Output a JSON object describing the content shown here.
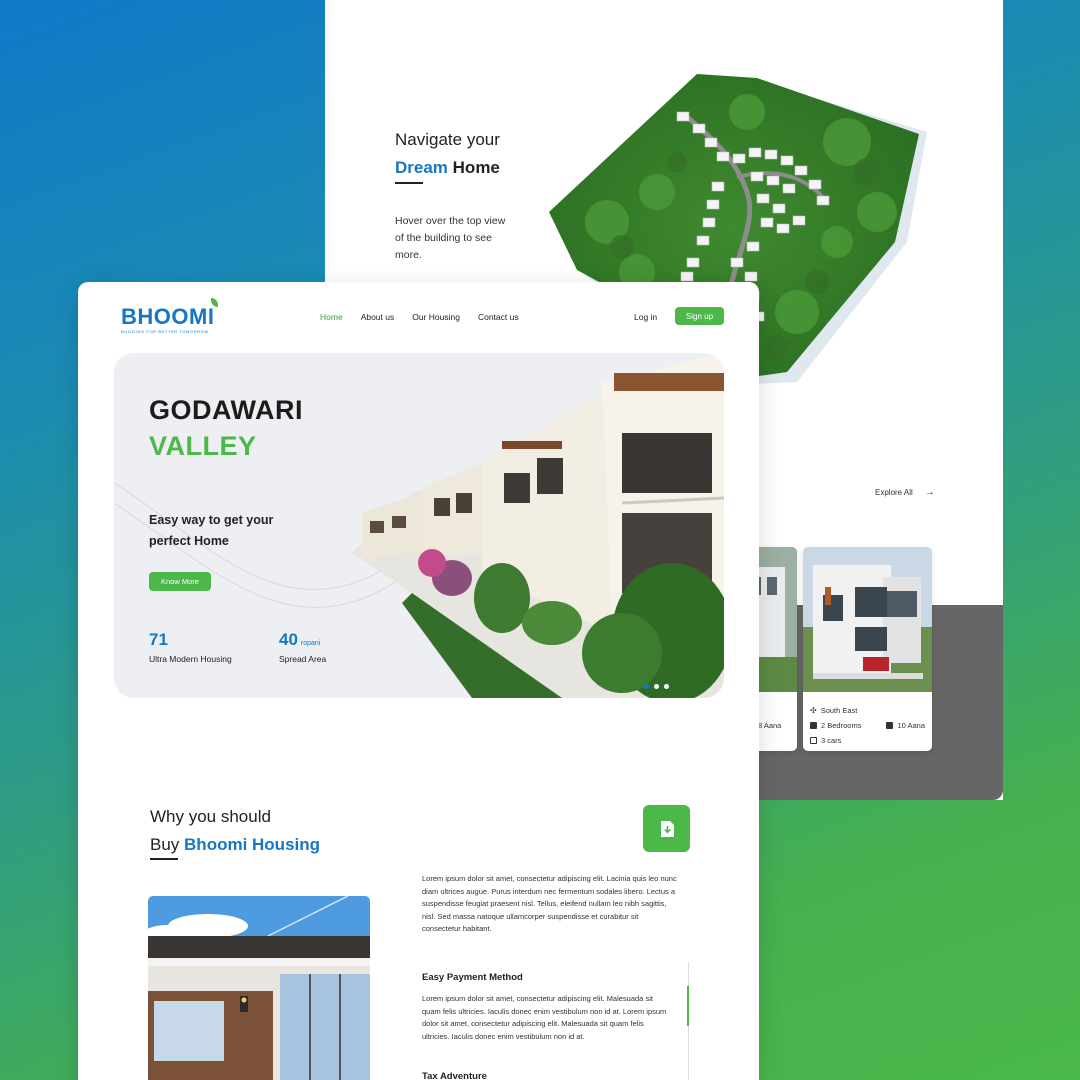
{
  "back": {
    "heading_line1": "Navigate your",
    "heading_highlight": "Dream",
    "heading_rest": "Home",
    "description": "Hover over the top view of the building to see more.",
    "explore_label": "Explore All",
    "cards": [
      {
        "partial_text": "8 Aana"
      },
      {
        "direction": "South East",
        "bedrooms": "2 Bedrooms",
        "area": "10 Aana",
        "parking": "3 cars"
      }
    ]
  },
  "front": {
    "logo": {
      "name": "BHOOMI",
      "tagline": "BUILDING FOR BETTER TOMORROW"
    },
    "nav": {
      "home": "Home",
      "about": "About us",
      "housing": "Our Housing",
      "contact": "Contact us"
    },
    "auth": {
      "login": "Log in",
      "signup": "Sign up"
    },
    "hero": {
      "title_line1": "GODAWARI",
      "title_line2": "VALLEY",
      "subtitle": "Easy way to get your perfect Home",
      "cta": "Know More",
      "stats": [
        {
          "value": "71",
          "unit": "",
          "label": "Ultra Modern Housing"
        },
        {
          "value": "40",
          "unit": "ropani",
          "label": "Spread Area"
        }
      ],
      "slide_active": 1,
      "slide_count": 3
    },
    "why": {
      "line1": "Why you should",
      "line2_prefix": "Buy",
      "line2_highlight": "Bhoomi Housing",
      "intro": "Lorem ipsum dolor sit amet, consectetur adipiscing elit. Lacinia quis leo nunc diam ultrices augue. Purus interdum nec fermentum sodales libero. Lectus a suspendisse feugiat praesent nisl. Tellus, eleifend nullam leo nibh sagittis, nisl. Sed massa natoque ullamcorper suspendisse et curabitur sit consectetur habitant.",
      "features": [
        {
          "title": "Easy Payment Method",
          "text": "Lorem ipsum dolor sit amet, consectetur adipiscing elit. Malesuada sit quam felis ultricies. Iaculis donec enim vestibulum non id at. Lorem ipsum dolor sit amet, consectetur adipiscing elit. Malesuada sit quam felis ultricies. Iaculis donec enim vestibulum non id at."
        },
        {
          "title": "Tax Adventure"
        }
      ]
    }
  },
  "colors": {
    "brand_blue": "#1677c2",
    "brand_green": "#4cb84a",
    "dark_gray_band": "#666666"
  }
}
